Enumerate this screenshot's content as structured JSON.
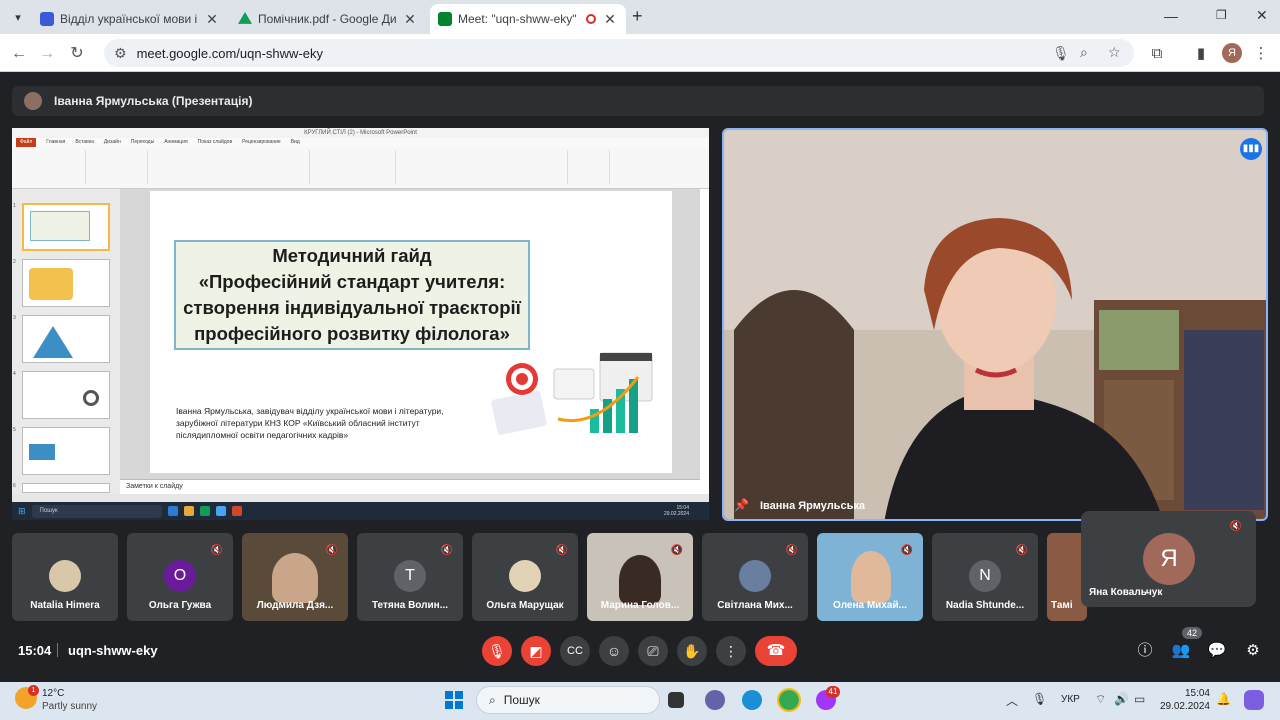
{
  "browser": {
    "tabs": [
      {
        "title": "Відділ української мови і літер",
        "favicon_color": "#3b5bd6"
      },
      {
        "title": "Помічник.pdf - Google Диск",
        "favicon_color": "#0f9d58"
      },
      {
        "title": "Meet: \"uqn-shww-eky\"",
        "favicon_color": "#00832d",
        "active": true
      }
    ],
    "new_tab": "+",
    "url": "meet.google.com/uqn-shww-eky",
    "profile_initial": "Я"
  },
  "meet": {
    "presenter_label": "Іванна Ярмульська (Презентація)",
    "main_speaker": "Іванна Ярмульська",
    "participants": [
      {
        "name": "Natalia Himera",
        "type": "photo",
        "color": "#d8c7a8"
      },
      {
        "name": "Ольга Гужва",
        "type": "initial",
        "initial": "О",
        "color": "#6a1b9a"
      },
      {
        "name": "Людмила Дзя...",
        "type": "video",
        "color": "#5a4a3a"
      },
      {
        "name": "Тетяна Волин...",
        "type": "initial",
        "initial": "Т",
        "color": "#5f6368"
      },
      {
        "name": "Ольга Марущак",
        "type": "photo",
        "color": "#e3d3b6"
      },
      {
        "name": "Марина Голов...",
        "type": "video",
        "color": "#c8c2b8"
      },
      {
        "name": "Світлана Мих...",
        "type": "photo",
        "color": "#6a7fa0"
      },
      {
        "name": "Олена Михай...",
        "type": "video",
        "color": "#7fb3d6"
      },
      {
        "name": "Nadia Shtunde...",
        "type": "initial",
        "initial": "N",
        "color": "#5f6368"
      },
      {
        "name": "Тамі",
        "type": "video",
        "color": "#8a5a44"
      }
    ],
    "self_tile": {
      "name": "Яна Ковальчук",
      "initial": "Я",
      "color": "#a1695a"
    },
    "time": "15:04",
    "meeting_code": "uqn-shww-eky",
    "people_count": "42"
  },
  "presentation": {
    "window_title": "КРУГЛИЙ СТІЛ (2) - Microsoft PowerPoint",
    "file_tab": "Файл",
    "ribbon_tabs": [
      "Главная",
      "Вставка",
      "Дизайн",
      "Переходы",
      "Анимация",
      "Показ слайдов",
      "Рецензирование",
      "Вид"
    ],
    "slide_title": [
      "Методичний гайд",
      "«Професійний стандарт учителя:",
      "створення індивідуальної траєкторії",
      "професійного розвитку філолога»"
    ],
    "slide_author": "Іванна Ярмульська, завідувач відділу української мови і літератури, зарубіжної літератури КНЗ КОР «Київський обласний інститут післядипломної освіти педагогічних кадрів»",
    "notes_placeholder": "Заметки к слайду",
    "inner_search": "Пошук",
    "inner_time": "15:04",
    "inner_date": "29.02.2024",
    "slide_numbers": [
      "1",
      "2",
      "3",
      "4",
      "5",
      "6"
    ]
  },
  "taskbar": {
    "weather_temp": "12°C",
    "weather_desc": "Partly sunny",
    "weather_badge": "1",
    "search_label": "Пошук",
    "lang": "УКР",
    "time": "15:04",
    "date": "29.02.2024",
    "app_badge": "41"
  }
}
